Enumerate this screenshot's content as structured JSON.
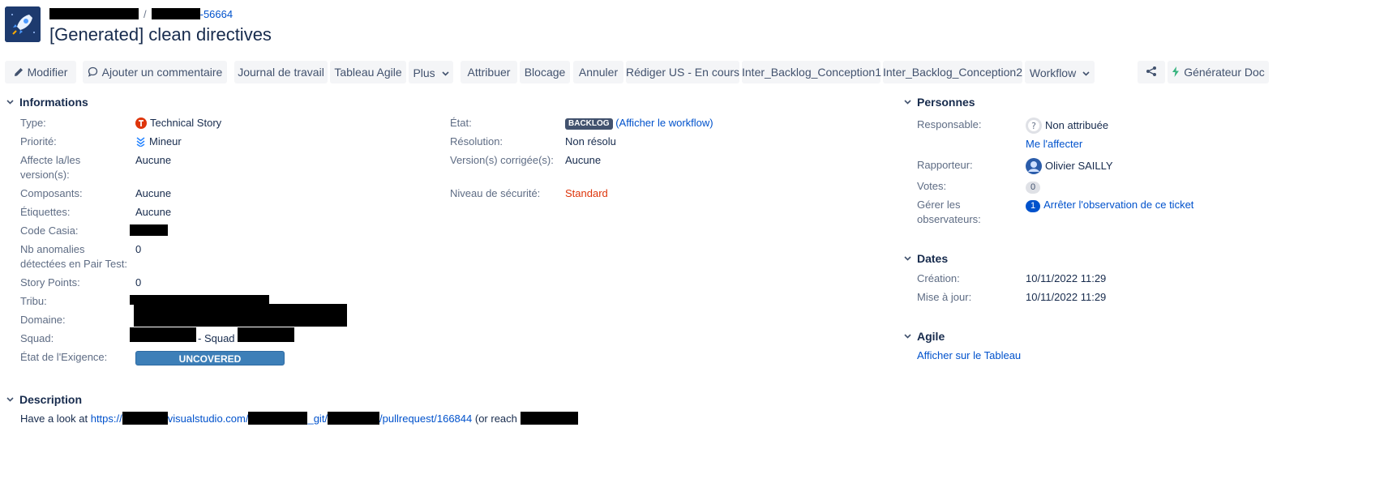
{
  "header": {
    "project_key_suffix": "-56664",
    "breadcrumb_separator": "/",
    "title": "[Generated] clean directives",
    "project_icon": "rocket-icon"
  },
  "toolbar": {
    "edit": "Modifier",
    "comment": "Ajouter un commentaire",
    "log_work": "Journal de travail",
    "agile_board": "Tableau Agile",
    "more": "Plus",
    "assign": "Attribuer",
    "block": "Blocage",
    "cancel": "Annuler",
    "write_us": "Rédiger US - En cours",
    "inter1": "Inter_Backlog_Conception1",
    "inter2": "Inter_Backlog_Conception2",
    "workflow": "Workflow",
    "share_icon": "share-icon",
    "doc_generator": "Générateur Doc"
  },
  "informations": {
    "heading": "Informations",
    "type_label": "Type:",
    "type_value": "Technical Story",
    "priority_label": "Priorité:",
    "priority_value": "Mineur",
    "affects_label_1": "Affecte la/les",
    "affects_label_2": "version(s):",
    "affects_value": "Aucune",
    "components_label": "Composants:",
    "components_value": "Aucune",
    "labels_label": "Étiquettes:",
    "labels_value": "Aucune",
    "code_casia_label": "Code Casia:",
    "anomalies_label_1": "Nb anomalies",
    "anomalies_label_2": "détectées en Pair Test:",
    "anomalies_value": "0",
    "story_points_label": "Story Points:",
    "story_points_value": "0",
    "tribu_label": "Tribu:",
    "domaine_label": "Domaine:",
    "squad_label": "Squad:",
    "squad_value_mid": "- Squad",
    "exigence_label": "État de l'Exigence:",
    "exigence_value": "UNCOVERED",
    "status_label": "État:",
    "status_value": "BACKLOG",
    "workflow_link": "(Afficher le workflow)",
    "resolution_label": "Résolution:",
    "resolution_value": "Non résolu",
    "fix_version_label": "Version(s) corrigée(s):",
    "fix_version_value": "Aucune",
    "security_label": "Niveau de sécurité:",
    "security_value": "Standard"
  },
  "people": {
    "heading": "Personnes",
    "assignee_label": "Responsable:",
    "assignee_value": "Non attribuée",
    "assign_me": "Me l'affecter",
    "reporter_label": "Rapporteur:",
    "reporter_value": "Olivier SAILLY",
    "votes_label": "Votes:",
    "votes_value": "0",
    "watchers_label_1": "Gérer les",
    "watchers_label_2": "observateurs:",
    "watchers_count": "1",
    "watchers_link": "Arrêter l'observation de ce ticket"
  },
  "dates": {
    "heading": "Dates",
    "created_label": "Création:",
    "created_value": "10/11/2022 11:29",
    "updated_label": "Mise à jour:",
    "updated_value": "10/11/2022 11:29"
  },
  "agile": {
    "heading": "Agile",
    "board_link": "Afficher sur le Tableau"
  },
  "description": {
    "heading": "Description",
    "prefix": "Have a look at ",
    "link_a": "https://",
    "link_b": "visualstudio.com/",
    "link_c": "_git/",
    "link_d": "/pullrequest/166844",
    "suffix": " (or reach "
  },
  "colors": {
    "link": "#0052cc",
    "lozenge": "#42526e",
    "security": "#de350b",
    "uncovered": "#3d7fb8",
    "type_icon": "#de350b"
  }
}
